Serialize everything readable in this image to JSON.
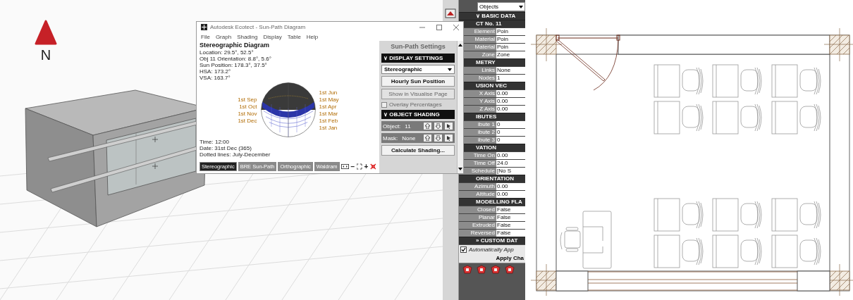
{
  "viewport": {
    "compass": "N"
  },
  "sun_path_window": {
    "title": "Autodesk Ecotect - Sun-Path Diagram",
    "menu": [
      "File",
      "Graph",
      "Shading",
      "Display",
      "Table",
      "Help"
    ],
    "diagram": {
      "title": "Stereographic Diagram",
      "info": [
        "Location: 29.5°, 52.5°",
        "Obj 11 Orientation: 8.8°, 5.6°",
        "Sun Position: 178.3°, 37.5°",
        "HSA: 173.2°",
        "VSA: 163.7°"
      ],
      "months_left": [
        "1st Sep",
        "1st Oct",
        "1st Nov",
        "1st Dec"
      ],
      "months_right": [
        "1st Jun",
        "1st May",
        "1st Apr",
        "1st Mar",
        "1st Feb",
        "1st Jan"
      ],
      "footer": [
        "Time: 12:00",
        "Date: 31st Dec (365)",
        "Dotted lines: July-December"
      ]
    },
    "view_tabs": [
      {
        "label": "Stereographic",
        "selected": true
      },
      {
        "label": "BRE Sun-Path",
        "selected": false
      },
      {
        "label": "Orthographic",
        "selected": false
      },
      {
        "label": "Waldram",
        "selected": false
      }
    ],
    "zoom_out": "−",
    "zoom_in": "+",
    "settings": {
      "title": "Sun-Path Settings",
      "sections": [
        {
          "label": "∨ DISPLAY SETTINGS",
          "items": [
            {
              "kind": "dropdown",
              "value": "Stereographic"
            },
            {
              "kind": "button",
              "label": "Hourly Sun Position",
              "disabled": false
            },
            {
              "kind": "button",
              "label": "Show in Visualise Page",
              "disabled": true
            },
            {
              "kind": "checkbox",
              "label": "Overlay Percentages",
              "checked": false,
              "disabled": true
            }
          ]
        },
        {
          "label": "∨ OBJECT SHADING",
          "items": [
            {
              "kind": "stepper",
              "label": "Object:",
              "value": "11"
            },
            {
              "kind": "stepper",
              "label": "Mask:",
              "value": "None"
            },
            {
              "kind": "button",
              "label": "Calculate Shading...",
              "disabled": false
            }
          ]
        }
      ]
    }
  },
  "properties_panel": {
    "selector": "Objects",
    "sections": [
      {
        "label": "∨ BASIC DATA"
      },
      {
        "label": "CT No. 11",
        "rows": [
          {
            "label": "Element",
            "value": "Poin"
          },
          {
            "label": "Material",
            "value": "Poin"
          },
          {
            "label": "Material",
            "value": "Poin"
          },
          {
            "label": "Zone",
            "value": "Zone"
          }
        ]
      },
      {
        "label": "METRY",
        "rows": [
          {
            "label": "Links",
            "value": "None"
          },
          {
            "label": "Nodes",
            "value": "1"
          }
        ]
      },
      {
        "label": "USION VEC",
        "rows": [
          {
            "label": "X Axis",
            "value": "0.00"
          },
          {
            "label": "Y Axis",
            "value": "0.00"
          },
          {
            "label": "Z Axis",
            "value": "0.00"
          }
        ]
      },
      {
        "label": "IBUTES",
        "rows": [
          {
            "label": "ibute 1",
            "value": "0"
          },
          {
            "label": "ibute 2",
            "value": "0"
          },
          {
            "label": "ibute 3",
            "value": "0"
          }
        ]
      },
      {
        "label": "VATION",
        "rows": [
          {
            "label": "Time On",
            "value": "0.00"
          },
          {
            "label": "Time Off",
            "value": "24.0"
          },
          {
            "label": "Schedule",
            "value": "[No S"
          }
        ]
      },
      {
        "label": "ORIENTATION",
        "rows": [
          {
            "label": "Azimuth",
            "value": "0.00"
          },
          {
            "label": "Altitude",
            "value": "0.00"
          }
        ]
      },
      {
        "label": "MODELLING FLA",
        "rows": [
          {
            "label": "Closed",
            "value": "False"
          },
          {
            "label": "Planar",
            "value": "False"
          },
          {
            "label": "Extruded",
            "value": "False"
          },
          {
            "label": "Reversed",
            "value": "False"
          }
        ]
      },
      {
        "label": "» CUSTOM DAT"
      }
    ],
    "auto_apply": {
      "label": "Automatically App",
      "checked": true
    },
    "apply_button": "Apply Cha"
  }
}
